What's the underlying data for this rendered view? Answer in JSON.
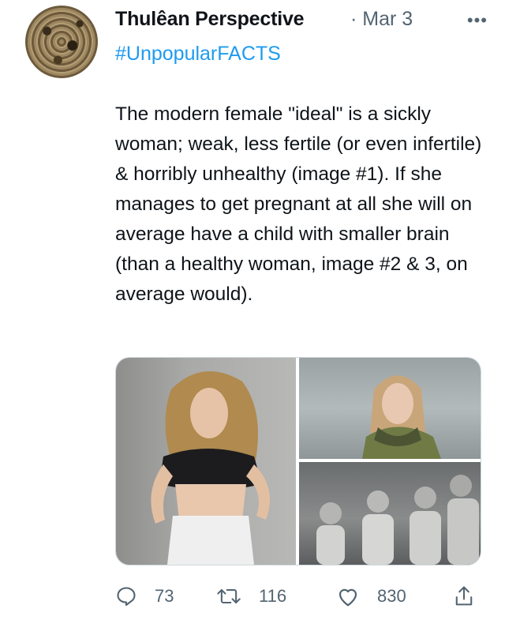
{
  "tweet": {
    "display_name": "Thulêan Perspective",
    "date": "· Mar 3",
    "more_label": "•••",
    "hashtag": "#UnpopularFACTS",
    "text": "The modern female \"ideal\" is a sickly woman; weak, less fertile (or even infertile) & horribly unhealthy (image #1). If she manages to get pregnant at all she will on average have a child with smaller brain (than a healthy woman, image #2 & 3, on average would).",
    "reply_count": "73",
    "retweet_count": "116",
    "like_count": "830"
  },
  "colors": {
    "link": "#1d9bf0",
    "secondary_text": "#536471",
    "primary_text": "#0f1419"
  },
  "icons": [
    "reply-icon",
    "retweet-icon",
    "like-icon",
    "share-icon"
  ]
}
